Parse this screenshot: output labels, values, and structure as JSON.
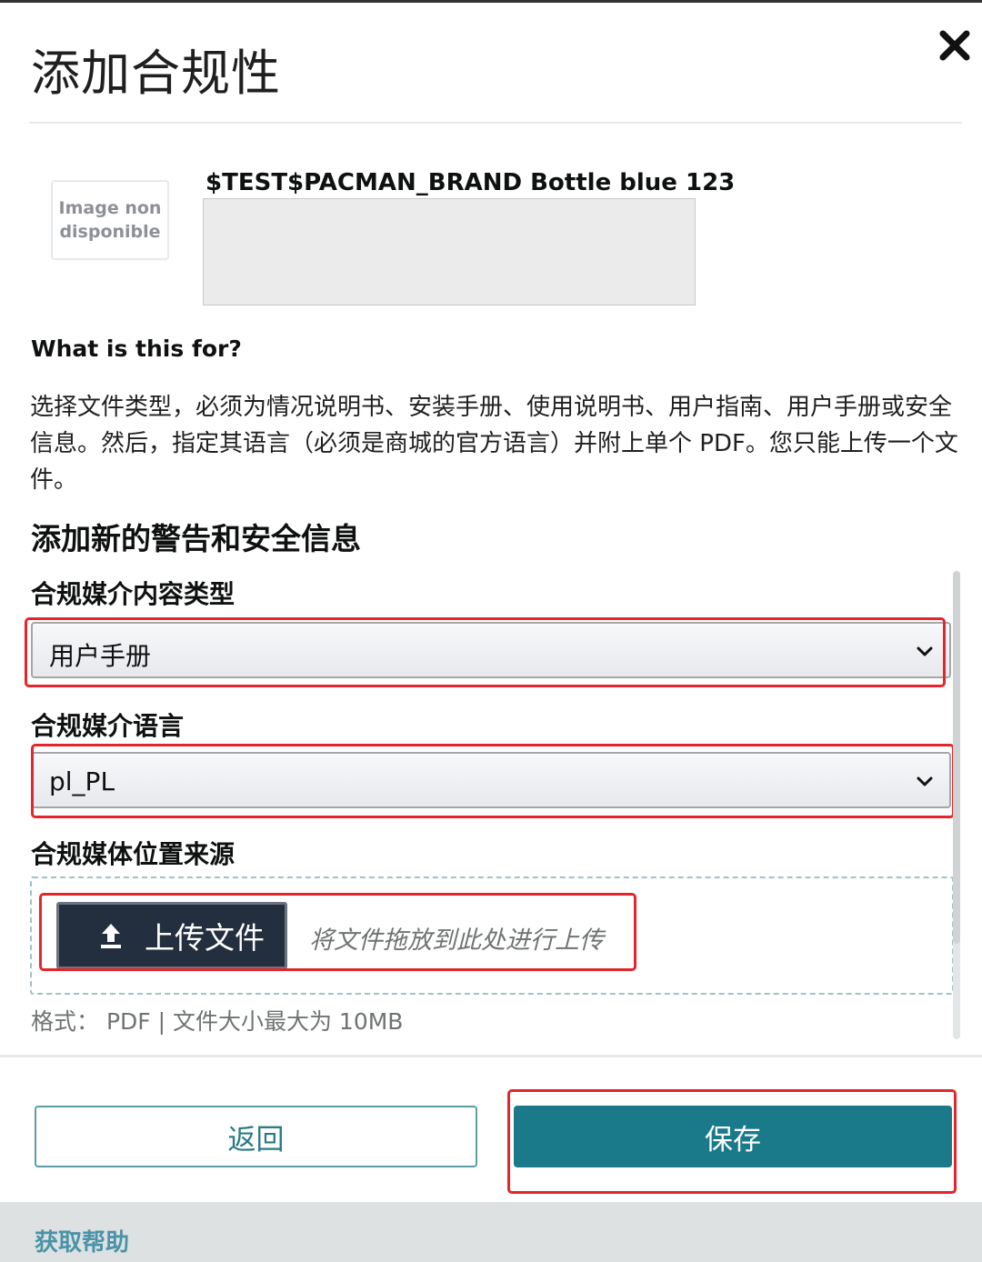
{
  "modal": {
    "title": "添加合规性"
  },
  "product": {
    "thumbnail_text": "Image non disponible",
    "name": "$TEST$PACMAN_BRAND Bottle blue 123"
  },
  "info": {
    "heading": "What is this for?",
    "text": "选择文件类型，必须为情况说明书、安装手册、使用说明书、用户指南、用户手册或安全信息。然后，指定其语言（必须是商城的官方语言）并附上单个 PDF。您只能上传一个文件。"
  },
  "section": {
    "heading": "添加新的警告和安全信息"
  },
  "fields": {
    "content_type": {
      "label": "合规媒介内容类型",
      "value": "用户手册"
    },
    "language": {
      "label": "合规媒介语言",
      "value": "pl_PL"
    },
    "source": {
      "label": "合规媒体位置来源"
    }
  },
  "upload": {
    "button_label": "上传文件",
    "drop_hint": "将文件拖放到此处进行上传",
    "format_note": "格式： PDF | 文件大小最大为 10MB"
  },
  "footer": {
    "back_label": "返回",
    "save_label": "保存"
  },
  "help": {
    "link_label": "获取帮助"
  },
  "icons": {
    "close": "close-icon",
    "dropdown": "chevron-down-icon",
    "upload": "upload-icon"
  },
  "colors": {
    "primary": "#1b7a8a",
    "highlight": "#e3262b",
    "upload_button": "#232f3e",
    "link": "#4a93a8"
  }
}
